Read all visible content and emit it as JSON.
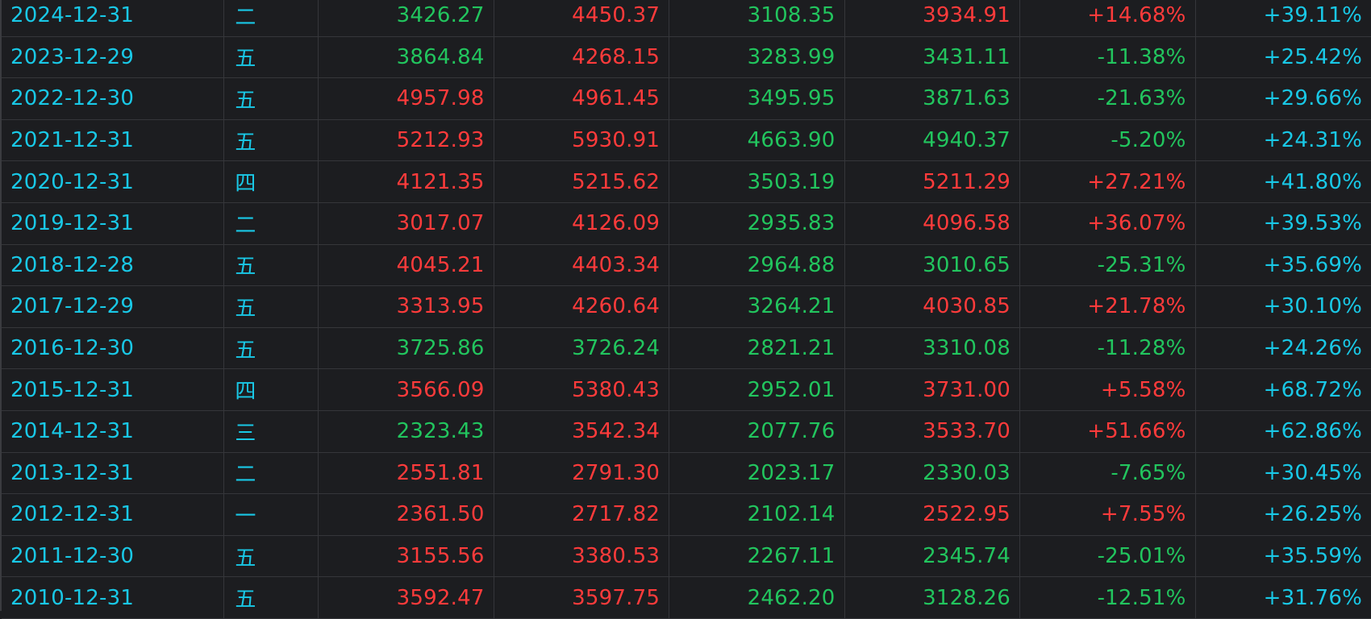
{
  "colors": {
    "cyan": "#19c8e6",
    "red": "#ff3b3b",
    "green": "#22c55e",
    "background": "#1c1d20"
  },
  "rows": [
    {
      "date": "2024-12-31",
      "weekday": "二",
      "open": "3426.27",
      "high": "4450.37",
      "low": "3108.35",
      "close": "3934.91",
      "change": "+14.68%",
      "amplitude": "+39.11%",
      "colors": [
        "green",
        "red",
        "green",
        "red",
        "red"
      ]
    },
    {
      "date": "2023-12-29",
      "weekday": "五",
      "open": "3864.84",
      "high": "4268.15",
      "low": "3283.99",
      "close": "3431.11",
      "change": "-11.38%",
      "amplitude": "+25.42%",
      "colors": [
        "green",
        "red",
        "green",
        "green",
        "green"
      ]
    },
    {
      "date": "2022-12-30",
      "weekday": "五",
      "open": "4957.98",
      "high": "4961.45",
      "low": "3495.95",
      "close": "3871.63",
      "change": "-21.63%",
      "amplitude": "+29.66%",
      "colors": [
        "red",
        "red",
        "green",
        "green",
        "green"
      ]
    },
    {
      "date": "2021-12-31",
      "weekday": "五",
      "open": "5212.93",
      "high": "5930.91",
      "low": "4663.90",
      "close": "4940.37",
      "change": "-5.20%",
      "amplitude": "+24.31%",
      "colors": [
        "red",
        "red",
        "green",
        "green",
        "green"
      ]
    },
    {
      "date": "2020-12-31",
      "weekday": "四",
      "open": "4121.35",
      "high": "5215.62",
      "low": "3503.19",
      "close": "5211.29",
      "change": "+27.21%",
      "amplitude": "+41.80%",
      "colors": [
        "red",
        "red",
        "green",
        "red",
        "red"
      ]
    },
    {
      "date": "2019-12-31",
      "weekday": "二",
      "open": "3017.07",
      "high": "4126.09",
      "low": "2935.83",
      "close": "4096.58",
      "change": "+36.07%",
      "amplitude": "+39.53%",
      "colors": [
        "red",
        "red",
        "green",
        "red",
        "red"
      ]
    },
    {
      "date": "2018-12-28",
      "weekday": "五",
      "open": "4045.21",
      "high": "4403.34",
      "low": "2964.88",
      "close": "3010.65",
      "change": "-25.31%",
      "amplitude": "+35.69%",
      "colors": [
        "red",
        "red",
        "green",
        "green",
        "green"
      ]
    },
    {
      "date": "2017-12-29",
      "weekday": "五",
      "open": "3313.95",
      "high": "4260.64",
      "low": "3264.21",
      "close": "4030.85",
      "change": "+21.78%",
      "amplitude": "+30.10%",
      "colors": [
        "red",
        "red",
        "green",
        "red",
        "red"
      ]
    },
    {
      "date": "2016-12-30",
      "weekday": "五",
      "open": "3725.86",
      "high": "3726.24",
      "low": "2821.21",
      "close": "3310.08",
      "change": "-11.28%",
      "amplitude": "+24.26%",
      "colors": [
        "green",
        "green",
        "green",
        "green",
        "green"
      ]
    },
    {
      "date": "2015-12-31",
      "weekday": "四",
      "open": "3566.09",
      "high": "5380.43",
      "low": "2952.01",
      "close": "3731.00",
      "change": "+5.58%",
      "amplitude": "+68.72%",
      "colors": [
        "red",
        "red",
        "green",
        "red",
        "red"
      ]
    },
    {
      "date": "2014-12-31",
      "weekday": "三",
      "open": "2323.43",
      "high": "3542.34",
      "low": "2077.76",
      "close": "3533.70",
      "change": "+51.66%",
      "amplitude": "+62.86%",
      "colors": [
        "green",
        "red",
        "green",
        "red",
        "red"
      ]
    },
    {
      "date": "2013-12-31",
      "weekday": "二",
      "open": "2551.81",
      "high": "2791.30",
      "low": "2023.17",
      "close": "2330.03",
      "change": "-7.65%",
      "amplitude": "+30.45%",
      "colors": [
        "red",
        "red",
        "green",
        "green",
        "green"
      ]
    },
    {
      "date": "2012-12-31",
      "weekday": "一",
      "open": "2361.50",
      "high": "2717.82",
      "low": "2102.14",
      "close": "2522.95",
      "change": "+7.55%",
      "amplitude": "+26.25%",
      "colors": [
        "red",
        "red",
        "green",
        "red",
        "red"
      ]
    },
    {
      "date": "2011-12-30",
      "weekday": "五",
      "open": "3155.56",
      "high": "3380.53",
      "low": "2267.11",
      "close": "2345.74",
      "change": "-25.01%",
      "amplitude": "+35.59%",
      "colors": [
        "red",
        "red",
        "green",
        "green",
        "green"
      ]
    },
    {
      "date": "2010-12-31",
      "weekday": "五",
      "open": "3592.47",
      "high": "3597.75",
      "low": "2462.20",
      "close": "3128.26",
      "change": "-12.51%",
      "amplitude": "+31.76%",
      "colors": [
        "red",
        "red",
        "green",
        "green",
        "green"
      ]
    }
  ]
}
